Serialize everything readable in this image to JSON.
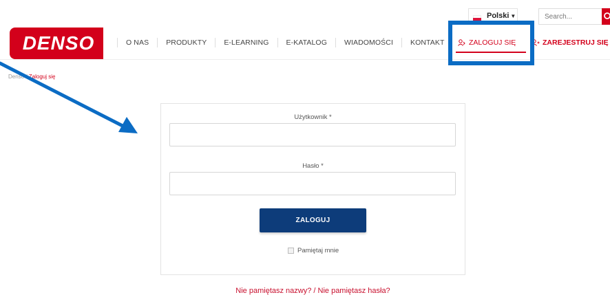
{
  "topbar": {
    "language": "Polski",
    "search_placeholder": "Search..."
  },
  "brand": {
    "logo_text": "DENSO",
    "accent": "#d3001b",
    "navy": "#0d3c7a",
    "annotation_blue": "#0b6cc4"
  },
  "nav": {
    "items": [
      "O NAS",
      "PRODUKTY",
      "E-LEARNING",
      "E-KATALOG",
      "WIADOMOŚCI",
      "KONTAKT"
    ],
    "login_label": "ZALOGUJ SIĘ",
    "register_label": "ZAREJESTRUJ SIĘ"
  },
  "breadcrumb": {
    "home": "Denso",
    "separator": " / ",
    "current": "Zaloguj się"
  },
  "login_form": {
    "username_label": "Użytkownik *",
    "username_value": "",
    "password_label": "Hasło *",
    "password_value": "",
    "submit_label": "ZALOGUJ",
    "remember_label": "Pamiętaj mnie"
  },
  "footer_links": {
    "forgot": "Nie pamiętasz nazwy? / Nie pamiętasz hasła?"
  }
}
